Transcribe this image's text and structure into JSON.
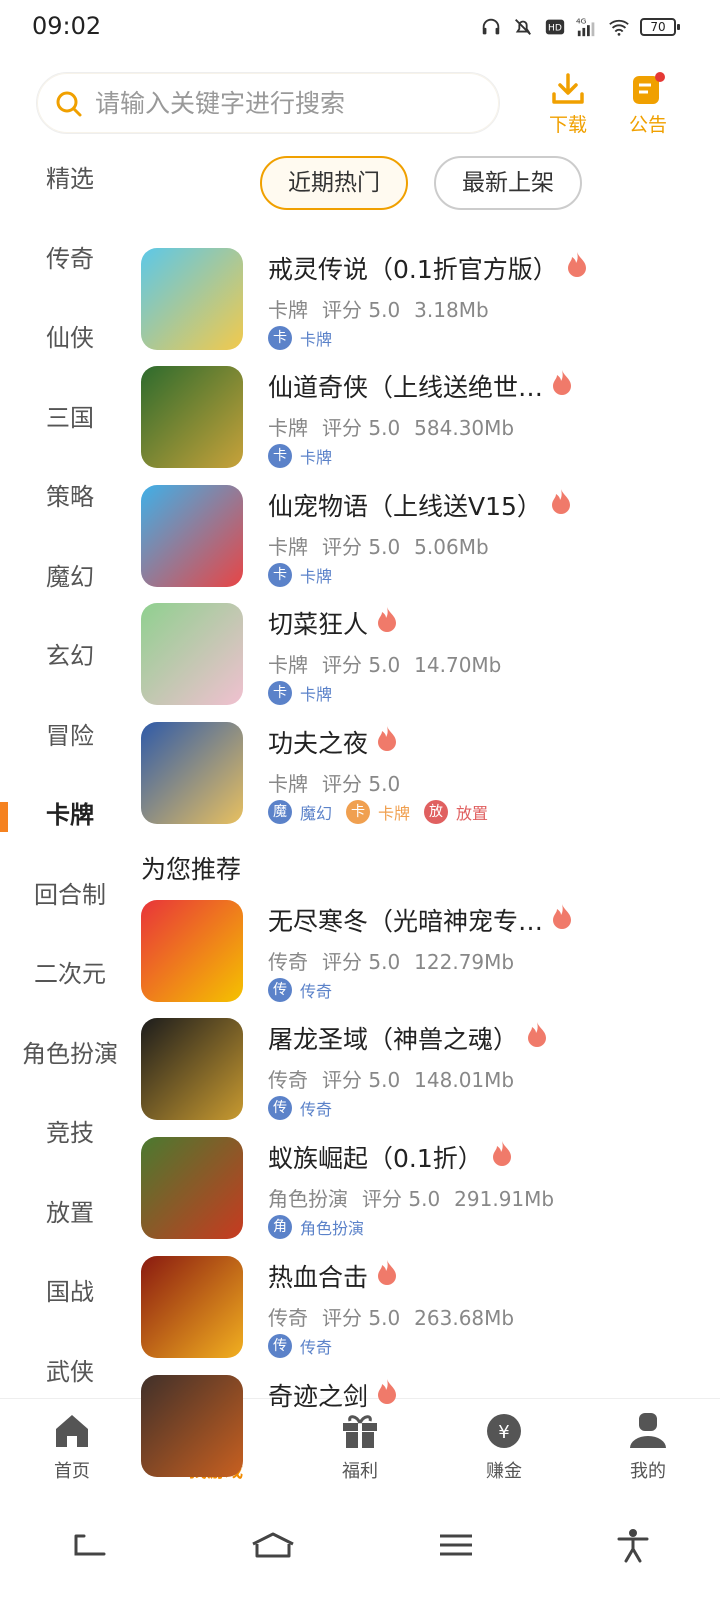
{
  "status": {
    "time": "09:02",
    "battery": "70",
    "network": "4G"
  },
  "search": {
    "placeholder": "请输入关键字进行搜索"
  },
  "top_actions": {
    "download": "下载",
    "notice": "公告"
  },
  "sidebar": {
    "items": [
      {
        "label": "精选"
      },
      {
        "label": "传奇"
      },
      {
        "label": "仙侠"
      },
      {
        "label": "三国"
      },
      {
        "label": "策略"
      },
      {
        "label": "魔幻"
      },
      {
        "label": "玄幻"
      },
      {
        "label": "冒险"
      },
      {
        "label": "卡牌",
        "active": true
      },
      {
        "label": "回合制"
      },
      {
        "label": "二次元"
      },
      {
        "label": "角色扮演"
      },
      {
        "label": "竞技"
      },
      {
        "label": "放置"
      },
      {
        "label": "国战"
      },
      {
        "label": "武侠"
      }
    ]
  },
  "tabs": [
    {
      "label": "近期热门",
      "active": true
    },
    {
      "label": "最新上架"
    }
  ],
  "games": [
    {
      "title": "戒灵传说（0.1折官方版）",
      "genre": "卡牌",
      "rating": "评分 5.0",
      "size": "3.18Mb",
      "tags": [
        {
          "icon": "卡",
          "label": "卡牌",
          "color": "blue"
        }
      ]
    },
    {
      "title": "仙道奇侠（上线送绝世…",
      "genre": "卡牌",
      "rating": "评分 5.0",
      "size": "584.30Mb",
      "tags": [
        {
          "icon": "卡",
          "label": "卡牌",
          "color": "blue"
        }
      ]
    },
    {
      "title": "仙宠物语（上线送V15）",
      "genre": "卡牌",
      "rating": "评分 5.0",
      "size": "5.06Mb",
      "tags": [
        {
          "icon": "卡",
          "label": "卡牌",
          "color": "blue"
        }
      ]
    },
    {
      "title": "切菜狂人",
      "genre": "卡牌",
      "rating": "评分 5.0",
      "size": "14.70Mb",
      "tags": [
        {
          "icon": "卡",
          "label": "卡牌",
          "color": "blue"
        }
      ]
    },
    {
      "title": "功夫之夜",
      "genre": "卡牌",
      "rating": "评分 5.0",
      "size": "",
      "tags": [
        {
          "icon": "魔",
          "label": "魔幻",
          "color": "blue"
        },
        {
          "icon": "卡",
          "label": "卡牌",
          "color": "orange"
        },
        {
          "icon": "放",
          "label": "放置",
          "color": "red"
        }
      ]
    }
  ],
  "recommend_title": "为您推荐",
  "recommend": [
    {
      "title": "无尽寒冬（光暗神宠专…",
      "genre": "传奇",
      "rating": "评分 5.0",
      "size": "122.79Mb",
      "tags": [
        {
          "icon": "传",
          "label": "传奇",
          "color": "blue"
        }
      ]
    },
    {
      "title": "屠龙圣域（神兽之魂）",
      "genre": "传奇",
      "rating": "评分 5.0",
      "size": "148.01Mb",
      "tags": [
        {
          "icon": "传",
          "label": "传奇",
          "color": "blue"
        }
      ]
    },
    {
      "title": "蚁族崛起（0.1折）",
      "genre": "角色扮演",
      "rating": "评分 5.0",
      "size": "291.91Mb",
      "tags": [
        {
          "icon": "角",
          "label": "角色扮演",
          "color": "blue"
        }
      ]
    },
    {
      "title": "热血合击",
      "genre": "传奇",
      "rating": "评分 5.0",
      "size": "263.68Mb",
      "tags": [
        {
          "icon": "传",
          "label": "传奇",
          "color": "blue"
        }
      ]
    },
    {
      "title": "奇迹之剑",
      "genre": "",
      "rating": "",
      "size": "",
      "tags": []
    }
  ],
  "bottom_nav": [
    {
      "label": "首页",
      "icon": "home-icon"
    },
    {
      "label": "找游戏",
      "icon": "compass-icon",
      "active": true
    },
    {
      "label": "福利",
      "icon": "gift-icon"
    },
    {
      "label": "赚金",
      "icon": "money-bag-icon"
    },
    {
      "label": "我的",
      "icon": "user-icon"
    }
  ],
  "colors": {
    "accent": "#f08a00",
    "tag_blue": "#5b82c9",
    "tag_orange": "#f0a050",
    "tag_red": "#e06060"
  }
}
